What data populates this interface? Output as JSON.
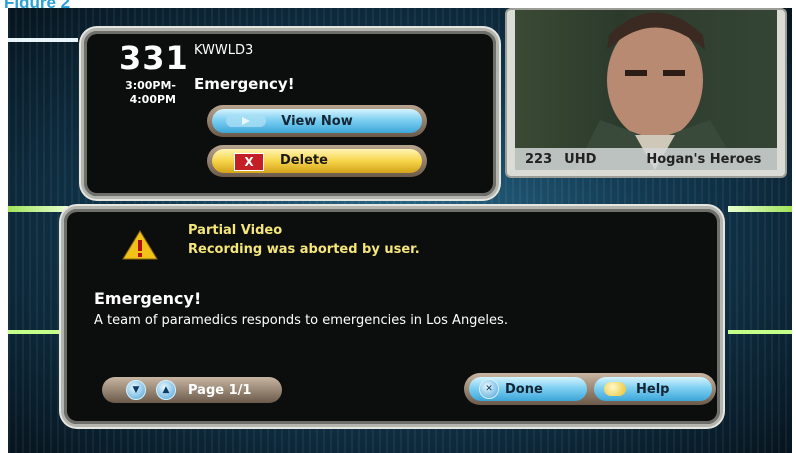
{
  "figure_label": "Figure 2",
  "info": {
    "channel": "331",
    "start_time": "3:00PM-",
    "end_time": "4:00PM",
    "callsign": "KWWLD3",
    "title": "Emergency!",
    "view_now_label": "View Now",
    "delete_label": "Delete"
  },
  "video": {
    "channel": "223",
    "callsign": "UHD",
    "program": "Hogan's Heroes"
  },
  "status": {
    "title": "Partial Video",
    "message": "Recording was aborted by user."
  },
  "description": {
    "title": "Emergency!",
    "text": "A team of paramedics responds to emergencies in Los Angeles."
  },
  "footer": {
    "page_label": "Page 1/1",
    "done_label": "Done",
    "help_label": "Help"
  },
  "colors": {
    "accent_blue": "#3ca6d8",
    "delete_yellow": "#f7d44a",
    "status_text": "#f4e67a",
    "figure_label": "#2aa0d8"
  },
  "icons": {
    "view_now": "play-icon",
    "delete": "x-icon",
    "warning": "warning-icon",
    "page_down": "arrow-down-icon",
    "page_up": "arrow-up-icon",
    "done": "close-icon",
    "help": "help-icon"
  }
}
